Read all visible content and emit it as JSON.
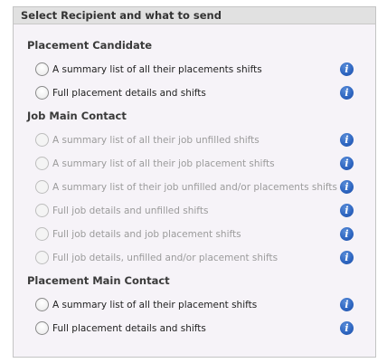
{
  "panel": {
    "title": "Select Recipient and what to send"
  },
  "sections": [
    {
      "title": "Placement Candidate",
      "options": [
        {
          "label": "A summary list of all their placements shifts",
          "disabled": false
        },
        {
          "label": "Full placement details and shifts",
          "disabled": false
        }
      ]
    },
    {
      "title": "Job Main Contact",
      "options": [
        {
          "label": "A summary list of all their job unfilled shifts",
          "disabled": true
        },
        {
          "label": "A summary list of all their job placement shifts",
          "disabled": true
        },
        {
          "label": "A summary list of their job unfilled and/or placements shifts",
          "disabled": true
        },
        {
          "label": "Full job details and unfilled shifts",
          "disabled": true
        },
        {
          "label": "Full job details and job placement shifts",
          "disabled": true
        },
        {
          "label": "Full job details, unfilled and/or placement shifts",
          "disabled": true
        }
      ]
    },
    {
      "title": "Placement Main Contact",
      "options": [
        {
          "label": "A summary list of all their placement shifts",
          "disabled": false
        },
        {
          "label": "Full placement details and shifts",
          "disabled": false
        }
      ]
    }
  ],
  "icons": {
    "radio": "radio-button-icon",
    "info": "info-icon",
    "info_glyph": "i"
  },
  "colors": {
    "info_blue": "#2f67c2",
    "disabled_text": "#9b9b9b",
    "header_bg": "#e1e1e1",
    "panel_bg": "#f6f3f8"
  }
}
